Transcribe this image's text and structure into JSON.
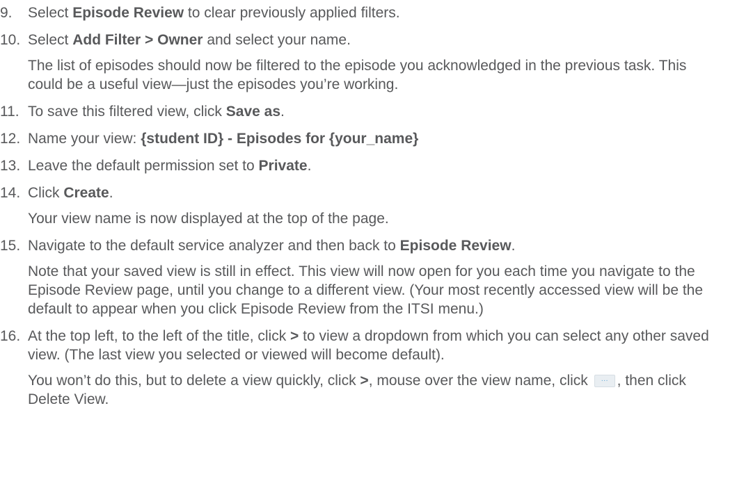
{
  "steps": [
    {
      "number": "9.",
      "parts": [
        "Select ",
        "Episode Review",
        " to clear previously applied filters."
      ]
    },
    {
      "number": "10.",
      "parts": [
        "Select ",
        "Add Filter > Owner",
        " and select your name."
      ],
      "note": "The list of episodes should now be filtered to the episode you acknowledged in the previous task. This could be a useful view—just the episodes you’re working."
    },
    {
      "number": "11.",
      "parts": [
        "To save this filtered view, click ",
        "Save as",
        "."
      ]
    },
    {
      "number": "12.",
      "parts": [
        "Name your view: ",
        "{student ID} - Episodes for {your_name}"
      ]
    },
    {
      "number": "13.",
      "parts": [
        "Leave the default permission set to ",
        "Private",
        "."
      ]
    },
    {
      "number": "14.",
      "parts": [
        "Click ",
        "Create",
        "."
      ],
      "note": "Your view name is now displayed at the top of the page."
    },
    {
      "number": "15.",
      "parts": [
        "Navigate to the default service analyzer and then back to ",
        "Episode Review",
        "."
      ],
      "note": "Note that your saved view is still in effect. This view will now open for you each time you navigate to the Episode Review page, until you change to a different view. (Your most recently accessed view will be the default to appear when you click Episode Review from the ITSI menu.)"
    },
    {
      "number": "16.",
      "parts": [
        "At the top left, to the left of the title, click ",
        ">",
        " to view a dropdown from which you can select any other saved view. (The last view you selected or viewed will become default)."
      ],
      "note_parts": [
        "You won’t do this, but to delete a view quickly, click ",
        ">",
        ", mouse over the view name, click ",
        ", then click Delete View."
      ]
    }
  ],
  "icons": {
    "more_options_icon": "ellipsis-menu-icon",
    "more_options_glyph": "···"
  },
  "colors": {
    "text": "#58595b",
    "icon_bg": "#e9eef2",
    "icon_dots": "#5aa6d6"
  }
}
